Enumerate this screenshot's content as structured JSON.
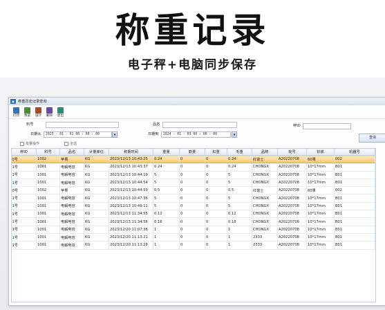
{
  "hero": {
    "title": "称重记录",
    "subtitle": "电子秤+电脑同步保存"
  },
  "window": {
    "title": "称重历史记录查询",
    "toolbar": [
      {
        "label": "打印",
        "icon": "printer-icon",
        "color": "#3b6fb6"
      },
      {
        "label": "预览",
        "icon": "preview-icon",
        "color": "#4d8a3c"
      },
      {
        "label": "设计",
        "icon": "design-icon",
        "color": "#b0462f"
      },
      {
        "label": "删除",
        "icon": "delete-icon",
        "color": "#6a4aa0"
      },
      {
        "label": "退出",
        "icon": "exit-icon",
        "color": "#2f8a7a"
      }
    ],
    "filters": {
      "material_no_label": "料号",
      "product_name_label": "品名",
      "scale_no_label": "秤ID",
      "date_from_label": "日期从",
      "date_from_value": "2023 - 01 - 01   00 : 00 : 00",
      "date_to_label": "日期到",
      "date_to_value": "2024 - 01 - 03   00 : 00 : 00",
      "batch_label": "批量操作",
      "select_all_label": "全选",
      "query_button": "查询"
    },
    "table": {
      "columns": [
        "秤ID",
        "料号",
        "品名",
        "计量单位",
        "称量时间",
        "重量",
        "数量",
        "扣重",
        "毛重",
        "品牌",
        "批号",
        "封装",
        "机器号"
      ],
      "rows": [
        [
          "0号",
          "1002",
          "苹果",
          "KG",
          "2023/12/13 10:43:25",
          "0.24",
          "0",
          "0",
          "0.24",
          "红富士",
          "A20220708",
          "60果",
          "002"
        ],
        [
          "1号",
          "1001",
          "电解电容",
          "KG",
          "2023/12/13 10:43:37",
          "0.24",
          "0",
          "0",
          "0.24",
          "CHONGX",
          "A20220708",
          "10*17mm",
          "B01"
        ],
        [
          "1号",
          "1001",
          "电解电容",
          "KG",
          "2023/12/13 10:44:19",
          "5",
          "0",
          "0",
          "5",
          "CHONGX",
          "A20220708",
          "10*17mm",
          "B01"
        ],
        [
          "1号",
          "1001",
          "电解电容",
          "KG",
          "2023/12/13 10:44:54",
          "5",
          "0",
          "0",
          "5",
          "CHONGX",
          "A20220708",
          "10*17mm",
          "B01"
        ],
        [
          "0号",
          "1002",
          "苹果",
          "KG",
          "2023/12/13 10:44:59",
          "0.5",
          "0",
          "0",
          "0.5",
          "红富士",
          "A20220708",
          "60果",
          "002"
        ],
        [
          "1号",
          "1001",
          "电解电容",
          "KG",
          "2023/12/13 10:47:36",
          "5",
          "0",
          "0",
          "5",
          "CHONGX",
          "A20220708",
          "10*17mm",
          "B01"
        ],
        [
          "1号",
          "1001",
          "电解电容",
          "KG",
          "2023/12/13 10:49:11",
          "5",
          "0",
          "0",
          "5",
          "CHONGX",
          "A20220708",
          "10*17mm",
          "B01"
        ],
        [
          "1号",
          "1001",
          "电解电容",
          "KG",
          "2023/12/13 11:34:55",
          "0.12",
          "0",
          "0",
          "0.12",
          "CHONGX",
          "A20220708",
          "10*17mm",
          "B01"
        ],
        [
          "1号",
          "1001",
          "电解电容",
          "KG",
          "2023/12/13 11:34:56",
          "0.18",
          "0",
          "0",
          "0.18",
          "CHONGX",
          "A20220708",
          "10*17mm",
          "B01"
        ],
        [
          "1号",
          "1001",
          "电解电容",
          "KG",
          "2023/12/20 11:07:36",
          "1",
          "0",
          "0",
          "1",
          "CHONGX",
          "A20220708",
          "10*17mm",
          "B01"
        ],
        [
          "1号",
          "1001",
          "电解电容",
          "KG",
          "2023/12/20 11:13:21",
          "1",
          "0",
          "0",
          "1",
          "2333",
          "A20220708",
          "10*17mm",
          "B01"
        ],
        [
          "1号",
          "1001",
          "电解电容",
          "KG",
          "2023/12/20 11:13:28",
          "1",
          "0",
          "0",
          "1",
          "2333",
          "A20220708",
          "10*17mm",
          "B01"
        ]
      ]
    }
  }
}
